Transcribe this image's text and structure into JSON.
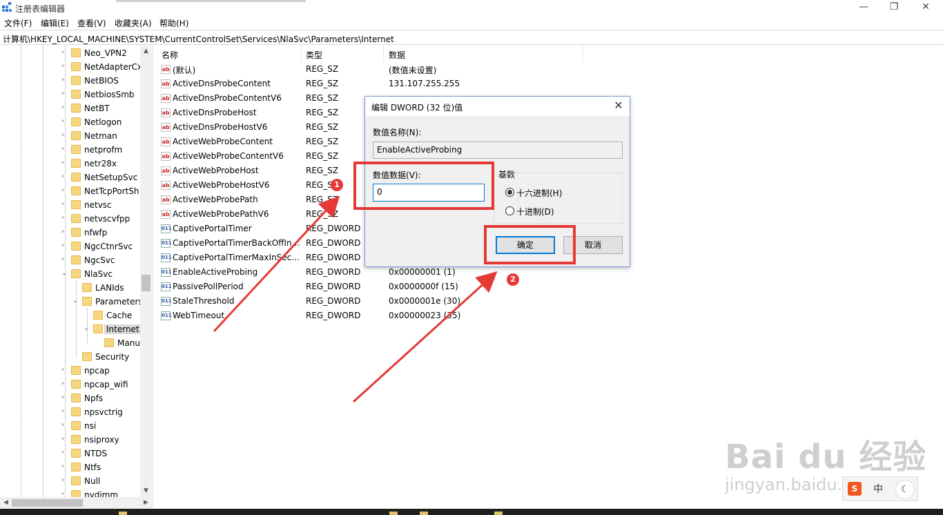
{
  "window": {
    "title": "注册表编辑器",
    "minimize": "—",
    "restore": "❐",
    "close": "✕"
  },
  "menu": [
    "文件(F)",
    "编辑(E)",
    "查看(V)",
    "收藏夹(A)",
    "帮助(H)"
  ],
  "address": "计算机\\HKEY_LOCAL_MACHINE\\SYSTEM\\CurrentControlSet\\Services\\NlaSvc\\Parameters\\Internet",
  "tree": {
    "items": [
      {
        "label": "Neo_VPN2"
      },
      {
        "label": "NetAdapterCx"
      },
      {
        "label": "NetBIOS"
      },
      {
        "label": "NetbiosSmb"
      },
      {
        "label": "NetBT"
      },
      {
        "label": "Netlogon"
      },
      {
        "label": "Netman"
      },
      {
        "label": "netprofm"
      },
      {
        "label": "netr28x"
      },
      {
        "label": "NetSetupSvc"
      },
      {
        "label": "NetTcpPortSh"
      },
      {
        "label": "netvsc"
      },
      {
        "label": "netvscvfpp"
      },
      {
        "label": "nfwfp"
      },
      {
        "label": "NgcCtnrSvc"
      },
      {
        "label": "NgcSvc"
      },
      {
        "label": "NlaSvc"
      },
      {
        "label": "LANIds"
      },
      {
        "label": "Parameters"
      },
      {
        "label": "Cache"
      },
      {
        "label": "Internet"
      },
      {
        "label": "Manu"
      },
      {
        "label": "Security"
      },
      {
        "label": "npcap"
      },
      {
        "label": "npcap_wifi"
      },
      {
        "label": "Npfs"
      },
      {
        "label": "npsvctrig"
      },
      {
        "label": "nsi"
      },
      {
        "label": "nsiproxy"
      },
      {
        "label": "NTDS"
      },
      {
        "label": "Ntfs"
      },
      {
        "label": "Null"
      },
      {
        "label": "nvdimm"
      }
    ]
  },
  "list": {
    "headers": {
      "name": "名称",
      "type": "类型",
      "data": "数据"
    },
    "rows": [
      {
        "icon": "ab",
        "name": "(默认)",
        "type": "REG_SZ",
        "data": "(数值未设置)"
      },
      {
        "icon": "ab",
        "name": "ActiveDnsProbeContent",
        "type": "REG_SZ",
        "data": "131.107.255.255"
      },
      {
        "icon": "ab",
        "name": "ActiveDnsProbeContentV6",
        "type": "REG_SZ",
        "data": ""
      },
      {
        "icon": "ab",
        "name": "ActiveDnsProbeHost",
        "type": "REG_SZ",
        "data": ""
      },
      {
        "icon": "ab",
        "name": "ActiveDnsProbeHostV6",
        "type": "REG_SZ",
        "data": ""
      },
      {
        "icon": "ab",
        "name": "ActiveWebProbeContent",
        "type": "REG_SZ",
        "data": ""
      },
      {
        "icon": "ab",
        "name": "ActiveWebProbeContentV6",
        "type": "REG_SZ",
        "data": ""
      },
      {
        "icon": "ab",
        "name": "ActiveWebProbeHost",
        "type": "REG_SZ",
        "data": ""
      },
      {
        "icon": "ab",
        "name": "ActiveWebProbeHostV6",
        "type": "REG_SZ",
        "data": ""
      },
      {
        "icon": "ab",
        "name": "ActiveWebProbePath",
        "type": "REG_SZ",
        "data": ""
      },
      {
        "icon": "ab",
        "name": "ActiveWebProbePathV6",
        "type": "REG_SZ",
        "data": ""
      },
      {
        "icon": "bin",
        "name": "CaptivePortalTimer",
        "type": "REG_DWORD",
        "data": ""
      },
      {
        "icon": "bin",
        "name": "CaptivePortalTimerBackOffInc...",
        "type": "REG_DWORD",
        "data": ""
      },
      {
        "icon": "bin",
        "name": "CaptivePortalTimerMaxInSeco...",
        "type": "REG_DWORD",
        "data": ""
      },
      {
        "icon": "bin",
        "name": "EnableActiveProbing",
        "type": "REG_DWORD",
        "data": "0x00000001 (1)"
      },
      {
        "icon": "bin",
        "name": "PassivePollPeriod",
        "type": "REG_DWORD",
        "data": "0x0000000f (15)"
      },
      {
        "icon": "bin",
        "name": "StaleThreshold",
        "type": "REG_DWORD",
        "data": "0x0000001e (30)"
      },
      {
        "icon": "bin",
        "name": "WebTimeout",
        "type": "REG_DWORD",
        "data": "0x00000023 (35)"
      }
    ]
  },
  "dialog": {
    "title": "编辑 DWORD (32 位)值",
    "close": "✕",
    "name_label": "数值名称(N):",
    "name_value": "EnableActiveProbing",
    "data_label": "数值数据(V):",
    "data_value": "0",
    "base_label": "基数",
    "radio_hex": "十六进制(H)",
    "radio_dec": "十进制(D)",
    "ok": "确定",
    "cancel": "取消"
  },
  "annotations": {
    "badge1": "1",
    "badge2": "2",
    "color": "#e53935"
  },
  "watermark": {
    "main": "Bai du 经验",
    "sub": "jingyan.baidu.com"
  },
  "ime": {
    "logo": "S",
    "lang": "中",
    "moon": "☾"
  },
  "icons": {
    "ab": "ab",
    "bin": "011"
  }
}
